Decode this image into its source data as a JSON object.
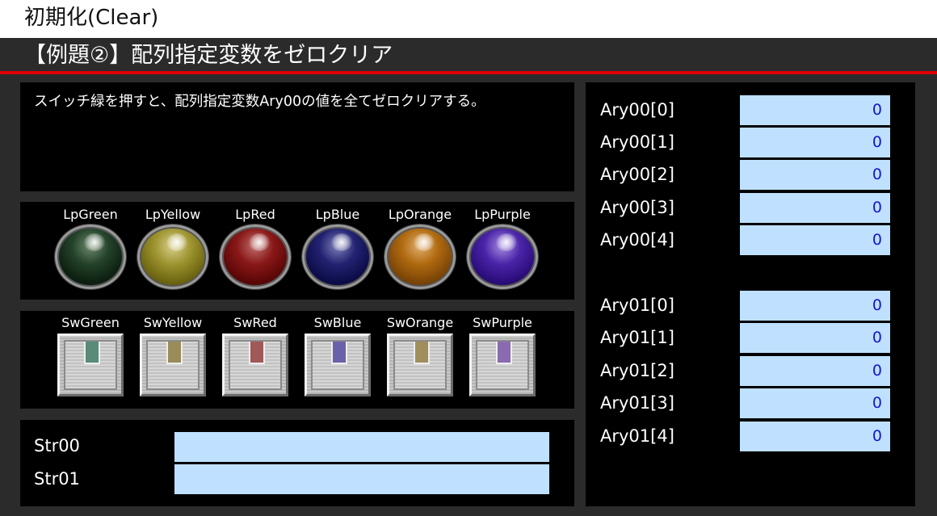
{
  "page_title": "初期化(Clear)",
  "section_header": "【例題②】配列指定変数をゼロクリア",
  "description": "スイッチ緑を押すと、配列指定変数Ary00の値を全てゼロクリアする。",
  "colors": {
    "accent_line": "#e00000",
    "field_bg": "#bfe1ff",
    "field_text": "#1515c8"
  },
  "lamps": [
    {
      "label": "LpGreen",
      "icon": "lamp-green-icon"
    },
    {
      "label": "LpYellow",
      "icon": "lamp-yellow-icon"
    },
    {
      "label": "LpRed",
      "icon": "lamp-red-icon"
    },
    {
      "label": "LpBlue",
      "icon": "lamp-blue-icon"
    },
    {
      "label": "LpOrange",
      "icon": "lamp-orange-icon"
    },
    {
      "label": "LpPurple",
      "icon": "lamp-purple-icon"
    }
  ],
  "switches": [
    {
      "label": "SwGreen"
    },
    {
      "label": "SwYellow"
    },
    {
      "label": "SwRed"
    },
    {
      "label": "SwBlue"
    },
    {
      "label": "SwOrange"
    },
    {
      "label": "SwPurple"
    }
  ],
  "strings": [
    {
      "label": "Str00",
      "value": ""
    },
    {
      "label": "Str01",
      "value": ""
    }
  ],
  "ary00": [
    {
      "label": "Ary00[0]",
      "value": "0"
    },
    {
      "label": "Ary00[1]",
      "value": "0"
    },
    {
      "label": "Ary00[2]",
      "value": "0"
    },
    {
      "label": "Ary00[3]",
      "value": "0"
    },
    {
      "label": "Ary00[4]",
      "value": "0"
    }
  ],
  "ary01": [
    {
      "label": "Ary01[0]",
      "value": "0"
    },
    {
      "label": "Ary01[1]",
      "value": "0"
    },
    {
      "label": "Ary01[2]",
      "value": "0"
    },
    {
      "label": "Ary01[3]",
      "value": "0"
    },
    {
      "label": "Ary01[4]",
      "value": "0"
    }
  ]
}
